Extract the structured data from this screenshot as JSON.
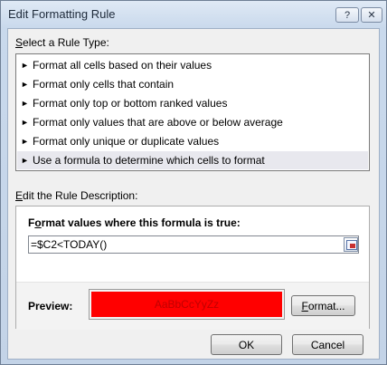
{
  "window": {
    "title": "Edit Formatting Rule",
    "help_glyph": "?",
    "close_glyph": "✕"
  },
  "rule_type": {
    "label_accel": "S",
    "label_rest": "elect a Rule Type:",
    "arrow_glyph": "►",
    "items": [
      {
        "label": "Format all cells based on their values"
      },
      {
        "label": "Format only cells that contain"
      },
      {
        "label": "Format only top or bottom ranked values"
      },
      {
        "label": "Format only values that are above or below average"
      },
      {
        "label": "Format only unique or duplicate values"
      },
      {
        "label": "Use a formula to determine which cells to format"
      }
    ],
    "selected": "Use a formula to determine which cells to format"
  },
  "description": {
    "label_accel": "E",
    "label_rest": "dit the Rule Description:",
    "formula_heading_before": "F",
    "formula_heading_accel": "o",
    "formula_heading_after": "rmat values where this formula is true:",
    "formula_value": "=$C2<TODAY()",
    "preview_label": "Preview:",
    "preview_sample": "AaBbCcYyZz",
    "preview_fill_color": "#ff0000",
    "preview_text_color": "#c00000",
    "format_button_accel": "F",
    "format_button_rest": "ormat..."
  },
  "buttons": {
    "ok": "OK",
    "cancel": "Cancel"
  }
}
